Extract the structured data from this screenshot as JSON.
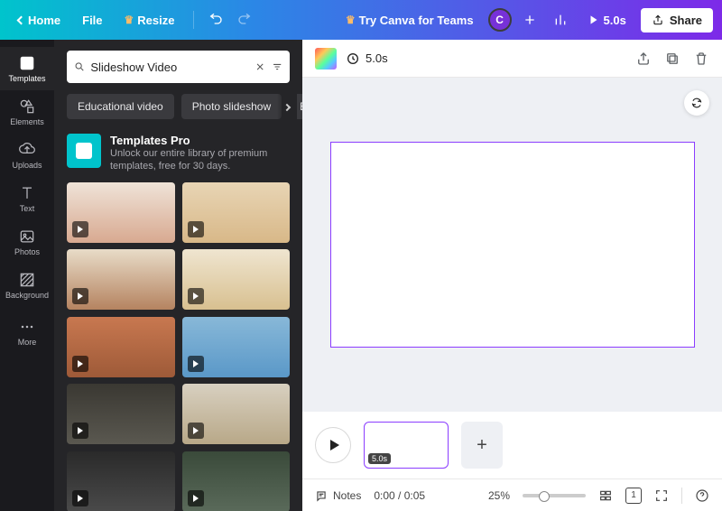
{
  "topbar": {
    "home": "Home",
    "file": "File",
    "resize": "Resize",
    "try_teams": "Try Canva for Teams",
    "avatar_letter": "C",
    "play_time": "5.0s",
    "share": "Share"
  },
  "rail": {
    "templates": "Templates",
    "elements": "Elements",
    "uploads": "Uploads",
    "text": "Text",
    "photos": "Photos",
    "background": "Background",
    "more": "More"
  },
  "search": {
    "value": "Slideshow Video"
  },
  "chips": {
    "c1": "Educational video",
    "c2": "Photo slideshow",
    "c3": "Bu"
  },
  "promo": {
    "title": "Templates Pro",
    "sub": "Unlock our entire library of premium templates, free for 30 days."
  },
  "canvas": {
    "top_time": "5.0s"
  },
  "timeline": {
    "slide_dur": "5.0s"
  },
  "footer": {
    "notes": "Notes",
    "timecode": "0:00 / 0:05",
    "zoom": "25%",
    "page_num": "1"
  }
}
